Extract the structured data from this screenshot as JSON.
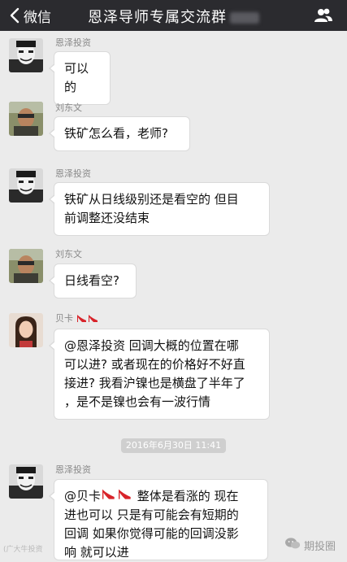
{
  "header": {
    "back_label": "微信",
    "title": "恩泽导师专属交流群"
  },
  "messages": [
    {
      "sender": "恩泽投资",
      "text": "可以的"
    },
    {
      "sender": "刘东文",
      "text": "铁矿怎么看，老师?"
    },
    {
      "sender": "恩泽投资",
      "lines": [
        "铁矿从日线级别还是看空的 但目",
        "前调整还没结束"
      ]
    },
    {
      "sender": "刘东文",
      "text": "日线看空?"
    },
    {
      "sender": "贝卡",
      "lines": [
        "@恩泽投资 回调大概的位置在哪",
        "可以进? 或者现在的价格好不好直",
        "接进? 我看沪镍也是横盘了半年了",
        "，是不是镍也会有一波行情"
      ]
    },
    {
      "sender": "恩泽投资",
      "mention": "@贝卡",
      "first_line_rest": " 整体是看涨的 现在",
      "lines": [
        "进也可以 只是有可能会有短期的",
        "回调 如果你觉得可能的回调没影",
        "响 就可以进"
      ]
    }
  ],
  "timestamp": "2016年6月30日 11:41",
  "watermark": {
    "left": "(广大牛投资",
    "right": "期投圈"
  },
  "colors": {
    "topbar": "#2b2b2f",
    "background": "#ebebeb",
    "heel": "#d8232a"
  },
  "icons": [
    "chevron-left-icon",
    "group-members-icon",
    "high-heel-icon",
    "wechat-logo-icon"
  ]
}
